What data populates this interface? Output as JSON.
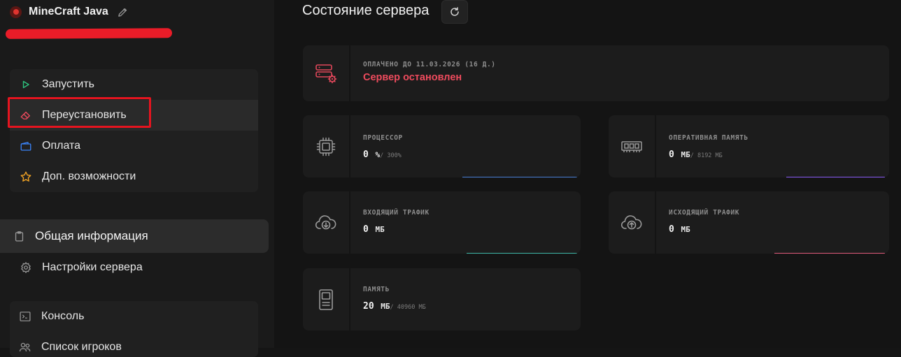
{
  "server": {
    "name": "MineCraft Java"
  },
  "menu": {
    "actions": [
      {
        "label": "Запустить"
      },
      {
        "label": "Переустановить"
      },
      {
        "label": "Оплата"
      },
      {
        "label": "Доп. возможности"
      }
    ],
    "active": {
      "label": "Общая информация"
    },
    "settings": {
      "label": "Настройки сервера"
    },
    "tools": [
      {
        "label": "Консоль"
      },
      {
        "label": "Список игроков"
      }
    ]
  },
  "header": {
    "title": "Состояние сервера"
  },
  "status_card": {
    "paid_until": "ОПЛАЧЕНО ДО 11.03.2026 (16 Д.)",
    "status": "Сервер остановлен"
  },
  "stats": [
    {
      "label": "ПРОЦЕССОР",
      "value": "0",
      "unit": "%",
      "max": "/ 300%",
      "icon": "cpu-icon"
    },
    {
      "label": "ОПЕРАТИВНАЯ ПАМЯТЬ",
      "value": "0",
      "unit": "МБ",
      "max": "/ 8192 МБ",
      "icon": "ram-icon"
    },
    {
      "label": "ВХОДЯЩИЙ ТРАФИК",
      "value": "0",
      "unit": "МБ",
      "icon": "cloud-download-icon"
    },
    {
      "label": "ИСХОДЯЩИЙ ТРАФИК",
      "value": "0",
      "unit": "МБ",
      "icon": "cloud-upload-icon"
    },
    {
      "label": "ПАМЯТЬ",
      "value": "20",
      "unit": "МБ",
      "max": "/ 40960 МБ",
      "icon": "disk-icon"
    }
  ],
  "colors": {
    "status_stopped": "#ee4b5d",
    "start_icon": "#2ec27e",
    "reinstall_icon": "#ee4b5d",
    "payment_icon": "#3b82f6",
    "extras_icon": "#f5a524",
    "cpu_bar": "#4a7fd6",
    "ram_bar": "#8b5cf6",
    "in_bar": "#3fb8a8",
    "out_bar": "#e05c7c",
    "highlight": "#e5141f"
  }
}
